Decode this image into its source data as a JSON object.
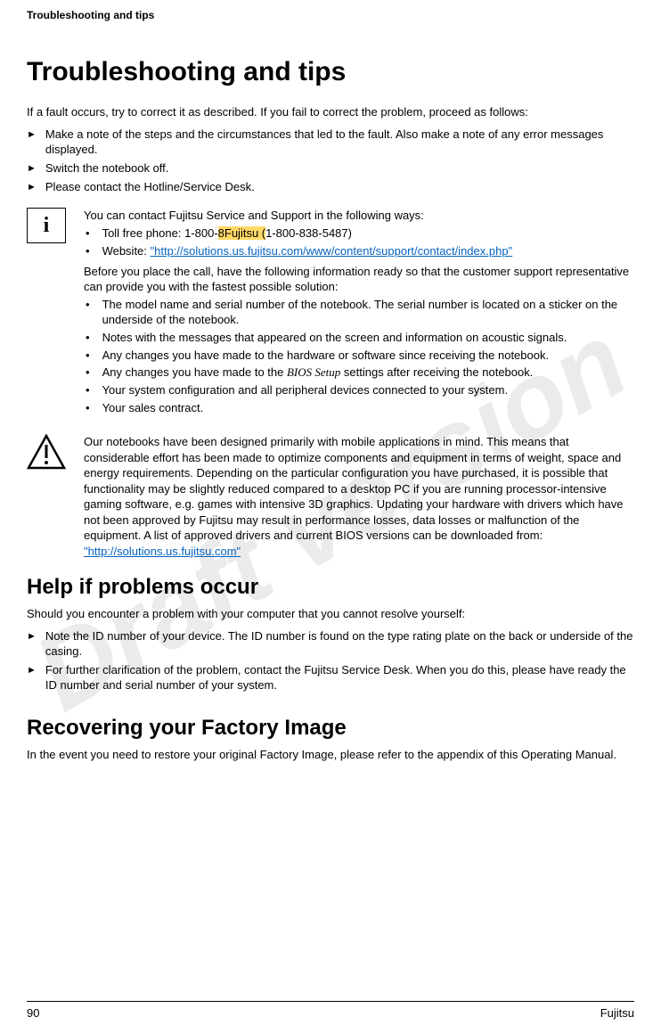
{
  "header": "Troubleshooting and tips",
  "title": "Troubleshooting and tips",
  "intro": "If a fault occurs, try to correct it as described. If you fail to correct the problem, proceed as follows:",
  "steps": [
    "Make a note of the steps and the circumstances that led to the fault. Also make a note of any error messages displayed.",
    "Switch the notebook off.",
    "Please contact the Hotline/Service Desk."
  ],
  "infoBox": {
    "intro": "You can contact Fujitsu Service and Support in the following ways:",
    "phoneLabel": "Toll free phone: 1-800-",
    "phoneHighlight": "8Fujitsu (",
    "phoneEnd": "1-800-838-5487)",
    "websiteLabel": "Website:    ",
    "websiteLink": "\"http://solutions.us.fujitsu.com/www/content/support/contact/index.php\"",
    "beforeCall": "Before you place the call, have the following information ready so that the customer support representative can provide you with the fastest possible solution:",
    "items": [
      "The model name and serial number of the notebook. The serial number is located on a sticker on the underside of the notebook.",
      "Notes with the messages that appeared on the screen and information on acoustic signals.",
      "Any changes you have made to the hardware or software since receiving the notebook.",
      {
        "prefix": "Any changes you have made to the ",
        "italic": "BIOS Setup",
        "suffix": " settings after receiving the notebook."
      },
      "Your system configuration and all peripheral devices connected to your system.",
      "Your sales contract."
    ]
  },
  "warningBox": {
    "text": "Our notebooks have been designed primarily with mobile applications in mind. This means that considerable effort has been made to optimize components and equipment in terms of weight, space and energy requirements. Depending on the particular configuration you have purchased, it is possible that functionality may be slightly reduced compared to a desktop PC if you are running processor-intensive gaming software, e.g. games with intensive 3D graphics. Updating your hardware with drivers which have not been approved by Fujitsu may result in performance losses, data losses or malfunction of the equipment. A list of approved drivers and current BIOS versions can be downloaded from: ",
    "link": "\"http://solutions.us.fujitsu.com\""
  },
  "helpSection": {
    "title": "Help if problems occur",
    "intro": "Should you encounter a problem with your computer that you cannot resolve yourself:",
    "steps": [
      "Note the ID number of your device. The ID number is found on the type rating plate on the back or underside of the casing.",
      "For further clarification of the problem, contact the Fujitsu Service Desk. When you do this, please have ready the ID number and serial number of your system."
    ]
  },
  "recoverySection": {
    "title": "Recovering your Factory Image",
    "text": "In the event you need to restore your original Factory Image, please refer to the appendix of this Operating Manual."
  },
  "footer": {
    "pageNumber": "90",
    "brand": "Fujitsu"
  },
  "watermark": "Draft version"
}
